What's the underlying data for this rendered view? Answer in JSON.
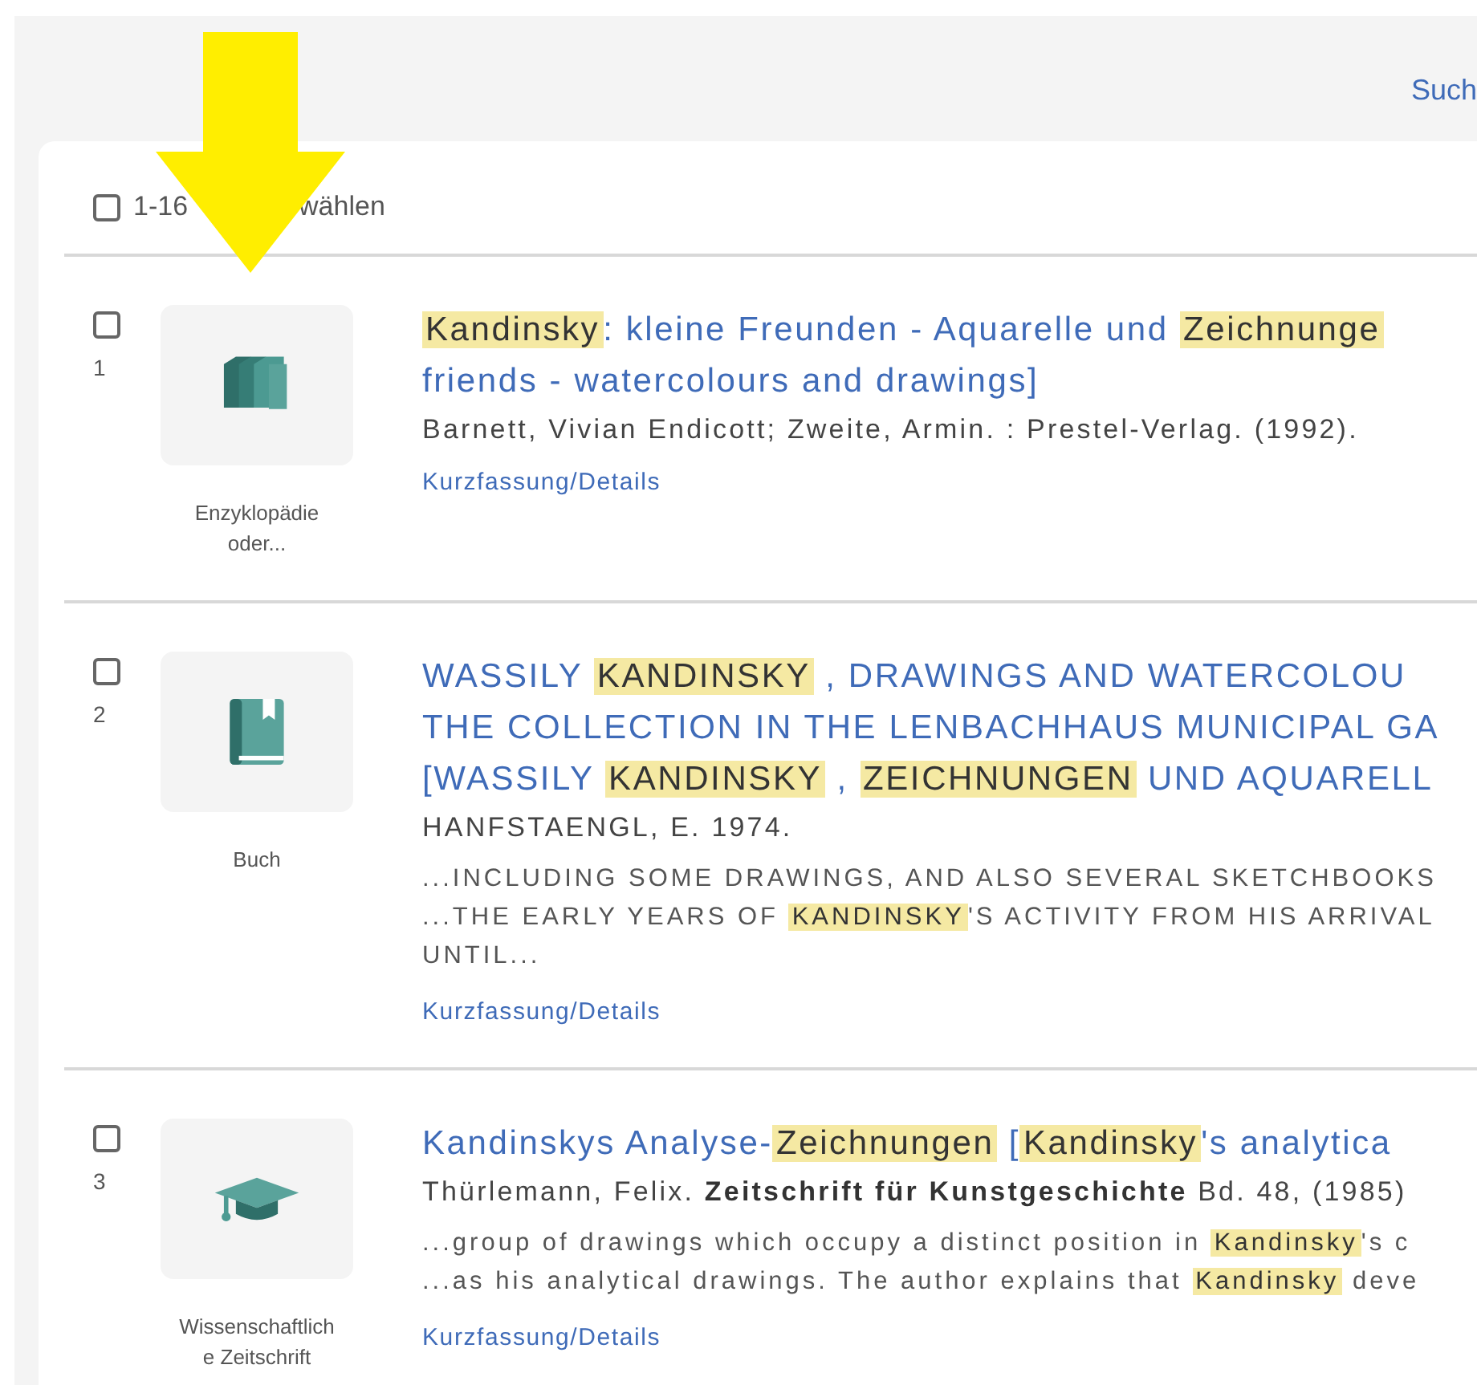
{
  "header": {
    "link": "Such"
  },
  "select_all": {
    "checked": false,
    "label_start": "1-16",
    "label_end": "wählen"
  },
  "annotation": {
    "kind": "arrow"
  },
  "results": [
    {
      "number": "1",
      "checked": false,
      "type": "Enzyklopädie oder...",
      "title_lines": [
        [
          {
            "text": "Kandinsky",
            "highlighted": true
          },
          {
            "text": ": kleine Freunden - Aquarelle und ",
            "highlighted": false
          },
          {
            "text": "Zeichnunge",
            "highlighted": true
          }
        ],
        [
          {
            "text": "friends - watercolours and drawings]",
            "highlighted": false
          }
        ]
      ],
      "author": "Barnett, Vivian Endicott; Zweite, Armin. : Prestel-Verlag. (1992).",
      "link": "Kurzfassung/Details"
    },
    {
      "number": "2",
      "checked": false,
      "type": "Buch",
      "title_lines": [
        [
          {
            "text": "WASSILY ",
            "highlighted": false
          },
          {
            "text": "KANDINSKY",
            "highlighted": true
          },
          {
            "text": " , DRAWINGS AND WATERCOLOU",
            "highlighted": false
          }
        ],
        [
          {
            "text": "THE COLLECTION IN THE LENBACHHAUS MUNICIPAL GA",
            "highlighted": false
          }
        ],
        [
          {
            "text": "[WASSILY ",
            "highlighted": false
          },
          {
            "text": "KANDINSKY",
            "highlighted": true
          },
          {
            "text": " , ",
            "highlighted": false
          },
          {
            "text": "ZEICHNUNGEN",
            "highlighted": true
          },
          {
            "text": " UND AQUARELL",
            "highlighted": false
          }
        ]
      ],
      "author": "HANFSTAENGL, E. 1974.",
      "snippets": [
        [
          {
            "text": "...INCLUDING SOME DRAWINGS, AND ALSO SEVERAL SKETCHBOOKS",
            "highlighted": false
          }
        ],
        [
          {
            "text": "...THE EARLY YEARS OF ",
            "highlighted": false
          },
          {
            "text": "KANDINSKY",
            "highlighted": true
          },
          {
            "text": "'S ACTIVITY FROM HIS ARRIVAL",
            "highlighted": false
          }
        ],
        [
          {
            "text": "UNTIL...",
            "highlighted": false
          }
        ]
      ],
      "link": "Kurzfassung/Details"
    },
    {
      "number": "3",
      "checked": false,
      "type": "Wissenschaftliche Zeitschrift",
      "title_lines": [
        [
          {
            "text": "Kandinskys Analyse-",
            "highlighted": false
          },
          {
            "text": "Zeichnungen",
            "highlighted": true
          },
          {
            "text": " [",
            "highlighted": false
          },
          {
            "text": "Kandinsky",
            "highlighted": true
          },
          {
            "text": "'s analytica",
            "highlighted": false
          }
        ]
      ],
      "author": "Thürlemann, Felix. **Zeitschrift für Kunstgeschichte** Bd. 48,  (1985)",
      "snippets": [
        [
          {
            "text": "...group of drawings which occupy a distinct position in ",
            "highlighted": false
          },
          {
            "text": "Kandinsky",
            "highlighted": true
          },
          {
            "text": "'s c",
            "highlighted": false
          }
        ],
        [
          {
            "text": "...as his analytical drawings. The author explains that ",
            "highlighted": false
          },
          {
            "text": "Kandinsky",
            "highlighted": true
          },
          {
            "text": " deve",
            "highlighted": false
          }
        ]
      ],
      "link": "Kurzfassung/Details"
    }
  ]
}
